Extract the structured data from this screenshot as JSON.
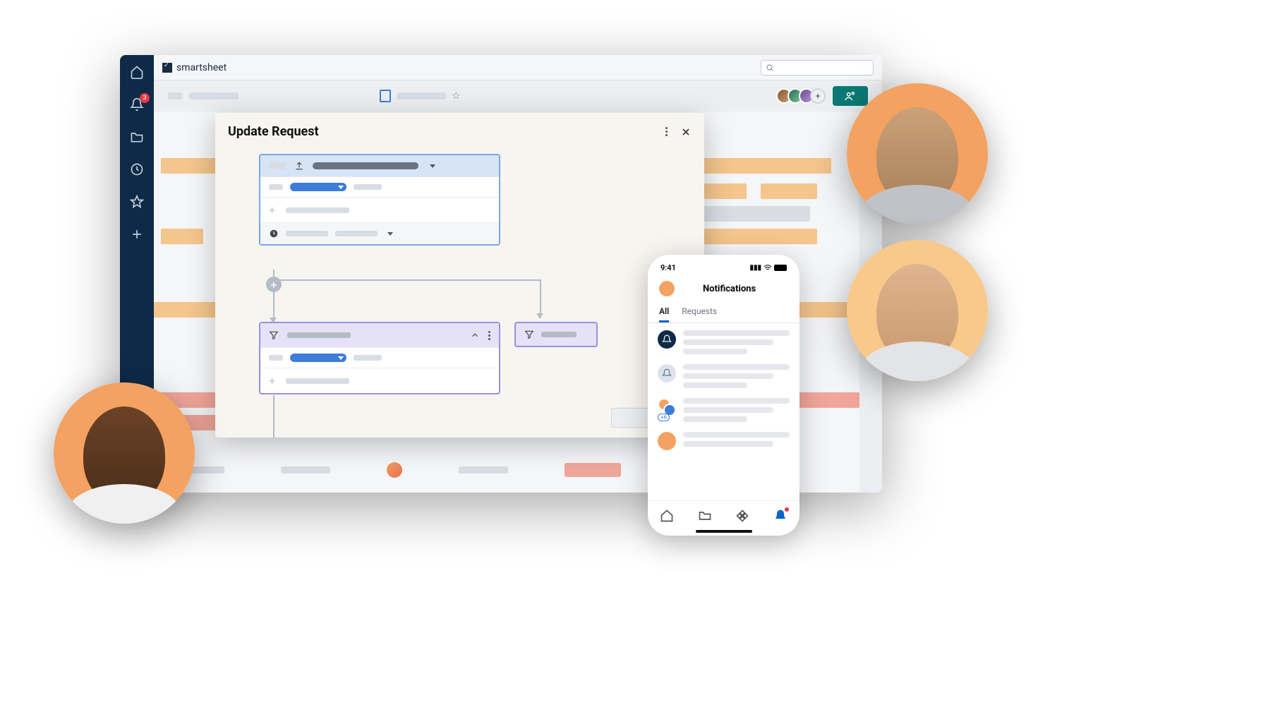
{
  "brand": {
    "name": "smartsheet"
  },
  "nav": {
    "notification_badge": "3"
  },
  "sub_header": {
    "avatars_plus": "+"
  },
  "modal": {
    "title": "Update Request"
  },
  "phone": {
    "time": "9:41",
    "title": "Notifications",
    "tabs": {
      "all": "All",
      "requests": "Requests"
    },
    "plus_badge": "+6"
  }
}
